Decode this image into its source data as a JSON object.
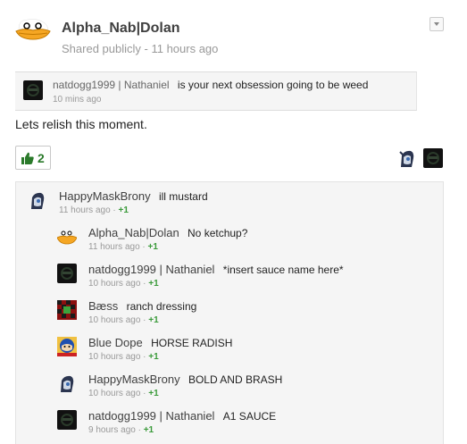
{
  "post": {
    "author": "Alpha_Nab|Dolan",
    "shared_label": "Shared publicly",
    "time": "11 hours ago",
    "reshare": {
      "name": "natdogg1999 | Nathaniel",
      "text": "is your next obsession going to be weed",
      "time": "10 mins ago"
    },
    "body": "Lets relish this moment.",
    "plus_count": "2"
  },
  "comments": [
    {
      "name": "HappyMaskBrony",
      "text": "ill mustard",
      "time": "11 hours ago",
      "plus": "+1",
      "avatar": "pony-avatar"
    },
    {
      "name": "Alpha_Nab|Dolan",
      "text": "No ketchup?",
      "time": "11 hours ago",
      "plus": "+1",
      "avatar": "duck-avatar"
    },
    {
      "name": "natdogg1999 | Nathaniel",
      "text": "*insert sauce name here*",
      "time": "10 hours ago",
      "plus": "+1",
      "avatar": "dark-avatar"
    },
    {
      "name": "Bæss",
      "text": "ranch dressing",
      "time": "10 hours ago",
      "plus": "+1",
      "avatar": "red-check-avatar"
    },
    {
      "name": "Blue Dope",
      "text": "HORSE RADISH",
      "time": "10 hours ago",
      "plus": "+1",
      "avatar": "blue-avatar"
    },
    {
      "name": "HappyMaskBrony",
      "text": "BOLD AND BRASH",
      "time": "10 hours ago",
      "plus": "+1",
      "avatar": "pony-avatar"
    },
    {
      "name": "natdogg1999 | Nathaniel",
      "text": "A1 SAUCE",
      "time": "9 hours ago",
      "plus": "+1",
      "avatar": "dark-avatar"
    }
  ],
  "colors": {
    "accent": "#2a7a2a",
    "plus_green": "#3a9a3a",
    "meta_gray": "#999999"
  }
}
